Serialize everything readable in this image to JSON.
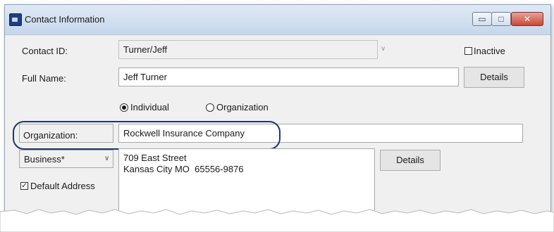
{
  "window": {
    "title": "Contact Information",
    "min_glyph": "▭",
    "max_glyph": "□",
    "close_glyph": "✕"
  },
  "contact_id": {
    "label": "Contact ID:",
    "value": "Turner/Jeff"
  },
  "inactive": {
    "label": "Inactive",
    "checked": false
  },
  "full_name": {
    "label": "Full Name:",
    "value": "Jeff Turner",
    "details_button": "Details"
  },
  "type": {
    "individual_label": "Individual",
    "organization_label": "Organization",
    "selected": "Individual"
  },
  "organization": {
    "label": "Organization:",
    "value": "Rockwell Insurance Company"
  },
  "address": {
    "type_selected": "Business*",
    "line1": "709 East Street",
    "line2": "Kansas City MO  65556-9876",
    "details_button": "Details",
    "default_label": "Default Address",
    "default_checked": true
  },
  "colors": {
    "highlight_border": "#1f3864",
    "window_bg": "#f0f0f0"
  }
}
